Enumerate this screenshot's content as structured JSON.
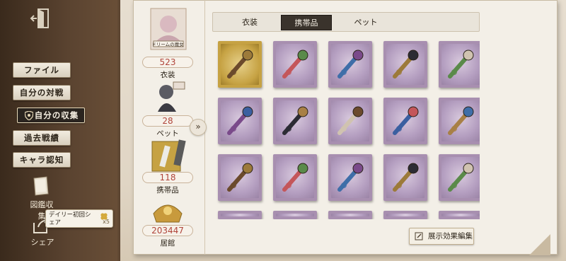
{
  "sidebar": {
    "items": [
      {
        "label": "ファイル"
      },
      {
        "label": "自分の対戦"
      },
      {
        "label": "自分の収集"
      },
      {
        "label": "過去戦績"
      },
      {
        "label": "キャラ認知"
      }
    ],
    "gallery_label": "図鑑収集",
    "share_label": "シェア",
    "daily_tip": {
      "line1": "デイリー初回シ",
      "line2": "ェア",
      "reward": "x5"
    }
  },
  "stats": [
    {
      "count": "523",
      "label": "衣装"
    },
    {
      "count": "28",
      "label": "ペット"
    },
    {
      "count": "118",
      "label": "携帯品"
    },
    {
      "count": "203447",
      "label": "居館"
    }
  ],
  "avatar_badge": "ドリームの魔女",
  "tabs": [
    {
      "label": "衣装"
    },
    {
      "label": "携帯品"
    },
    {
      "label": "ペット"
    }
  ],
  "active_tab": "携帯品",
  "footer": {
    "edit_button": "展示効果編集"
  },
  "colors": {
    "accent": "#b0453b",
    "stamp_purple": "#a88fb0",
    "stamp_gold": "#c6a243",
    "active_tab": "#3a332c"
  },
  "grid_items": [
    {
      "icon": "golden-mask-ornament-icon",
      "frame": "gold"
    },
    {
      "icon": "candy-heart-charm-icon",
      "frame": "purple"
    },
    {
      "icon": "gem-scepter-icon",
      "frame": "purple"
    },
    {
      "icon": "ornate-baton-icon",
      "frame": "purple"
    },
    {
      "icon": "crystal-staff-icon",
      "frame": "purple"
    },
    {
      "icon": "antler-claw-icon",
      "frame": "purple"
    },
    {
      "icon": "dark-orb-rattle-icon",
      "frame": "purple"
    },
    {
      "icon": "blue-wing-orb-icon",
      "frame": "purple"
    },
    {
      "icon": "spiked-mace-icon",
      "frame": "purple"
    },
    {
      "icon": "bamboo-staff-icon",
      "frame": "purple"
    },
    {
      "icon": "spellbook-tag-icon",
      "frame": "purple"
    },
    {
      "icon": "black-satchel-icon",
      "frame": "purple"
    },
    {
      "icon": "pearl-orb-icon",
      "frame": "purple"
    },
    {
      "icon": "umbrella-hook-icon",
      "frame": "purple"
    },
    {
      "icon": "folding-fan-icon",
      "frame": "purple"
    }
  ]
}
